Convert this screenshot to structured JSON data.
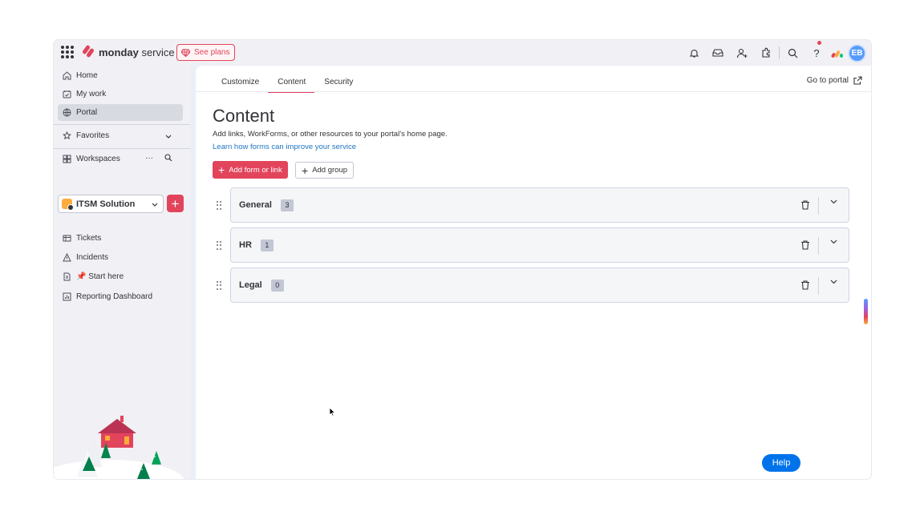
{
  "topbar": {
    "brand_bold": "monday",
    "brand_light": " service",
    "see_plans": "See plans",
    "avatar_initials": "EB",
    "icons": [
      "notifications-icon",
      "inbox-icon",
      "invite-members-icon",
      "apps-icon",
      "search-icon",
      "help-icon"
    ]
  },
  "sidebar": {
    "items": [
      {
        "label": "Home",
        "icon": "home-icon"
      },
      {
        "label": "My work",
        "icon": "my-work-icon"
      },
      {
        "label": "Portal",
        "icon": "portal-icon",
        "active": true
      }
    ],
    "favorites_label": "Favorites",
    "workspaces_label": "Workspaces",
    "workspace_name": "ITSM Solution",
    "boards": [
      {
        "label": "Tickets",
        "icon": "board-icon"
      },
      {
        "label": "Incidents",
        "icon": "warning-icon"
      },
      {
        "label": "📌 Start here",
        "icon": "doc-icon"
      },
      {
        "label": "Reporting Dashboard",
        "icon": "dashboard-icon"
      }
    ]
  },
  "main": {
    "tabs": [
      {
        "label": "Customize"
      },
      {
        "label": "Content",
        "active": true
      },
      {
        "label": "Security"
      }
    ],
    "go_to_portal": "Go to portal",
    "title": "Content",
    "subtitle": "Add links, WorkForms, or other resources to your portal’s home page.",
    "learn_link": "Learn how forms can improve your service",
    "add_form_button": "Add form or link",
    "add_group_button": "Add group",
    "groups": [
      {
        "name": "General",
        "count": "3"
      },
      {
        "name": "HR",
        "count": "1"
      },
      {
        "name": "Legal",
        "count": "0"
      }
    ]
  },
  "help_button": "Help",
  "colors": {
    "accent": "#e2445c",
    "link": "#1f76c2",
    "help": "#0073ea",
    "avatar": "#579bfc"
  }
}
